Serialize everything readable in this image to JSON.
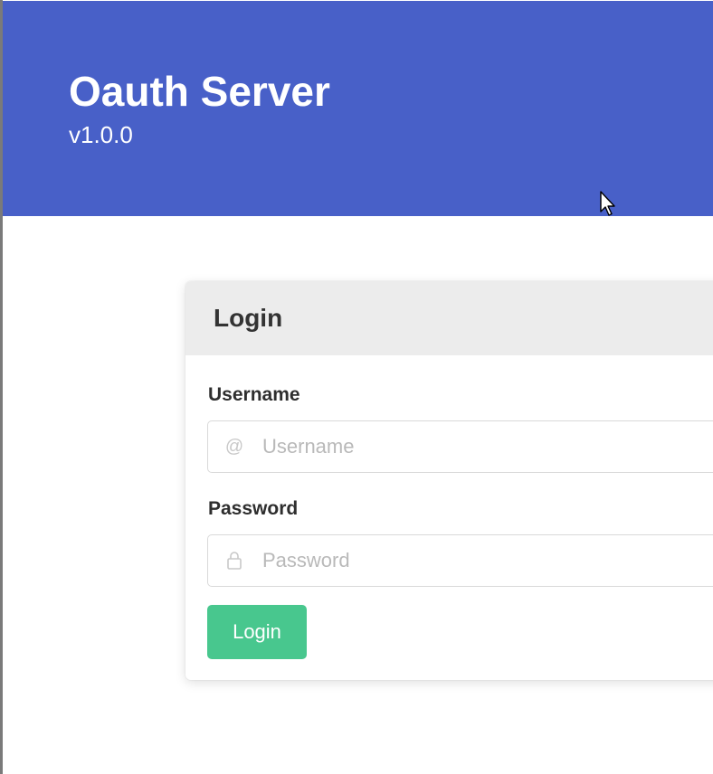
{
  "hero": {
    "title": "Oauth Server",
    "subtitle": "v1.0.0",
    "background_color": "#4860c8"
  },
  "login_card": {
    "title": "Login",
    "username": {
      "label": "Username",
      "placeholder": "Username",
      "value": "",
      "icon": "at-icon"
    },
    "password": {
      "label": "Password",
      "placeholder": "Password",
      "value": "",
      "icon": "lock-icon"
    },
    "submit_label": "Login",
    "submit_color": "#48c78e"
  }
}
